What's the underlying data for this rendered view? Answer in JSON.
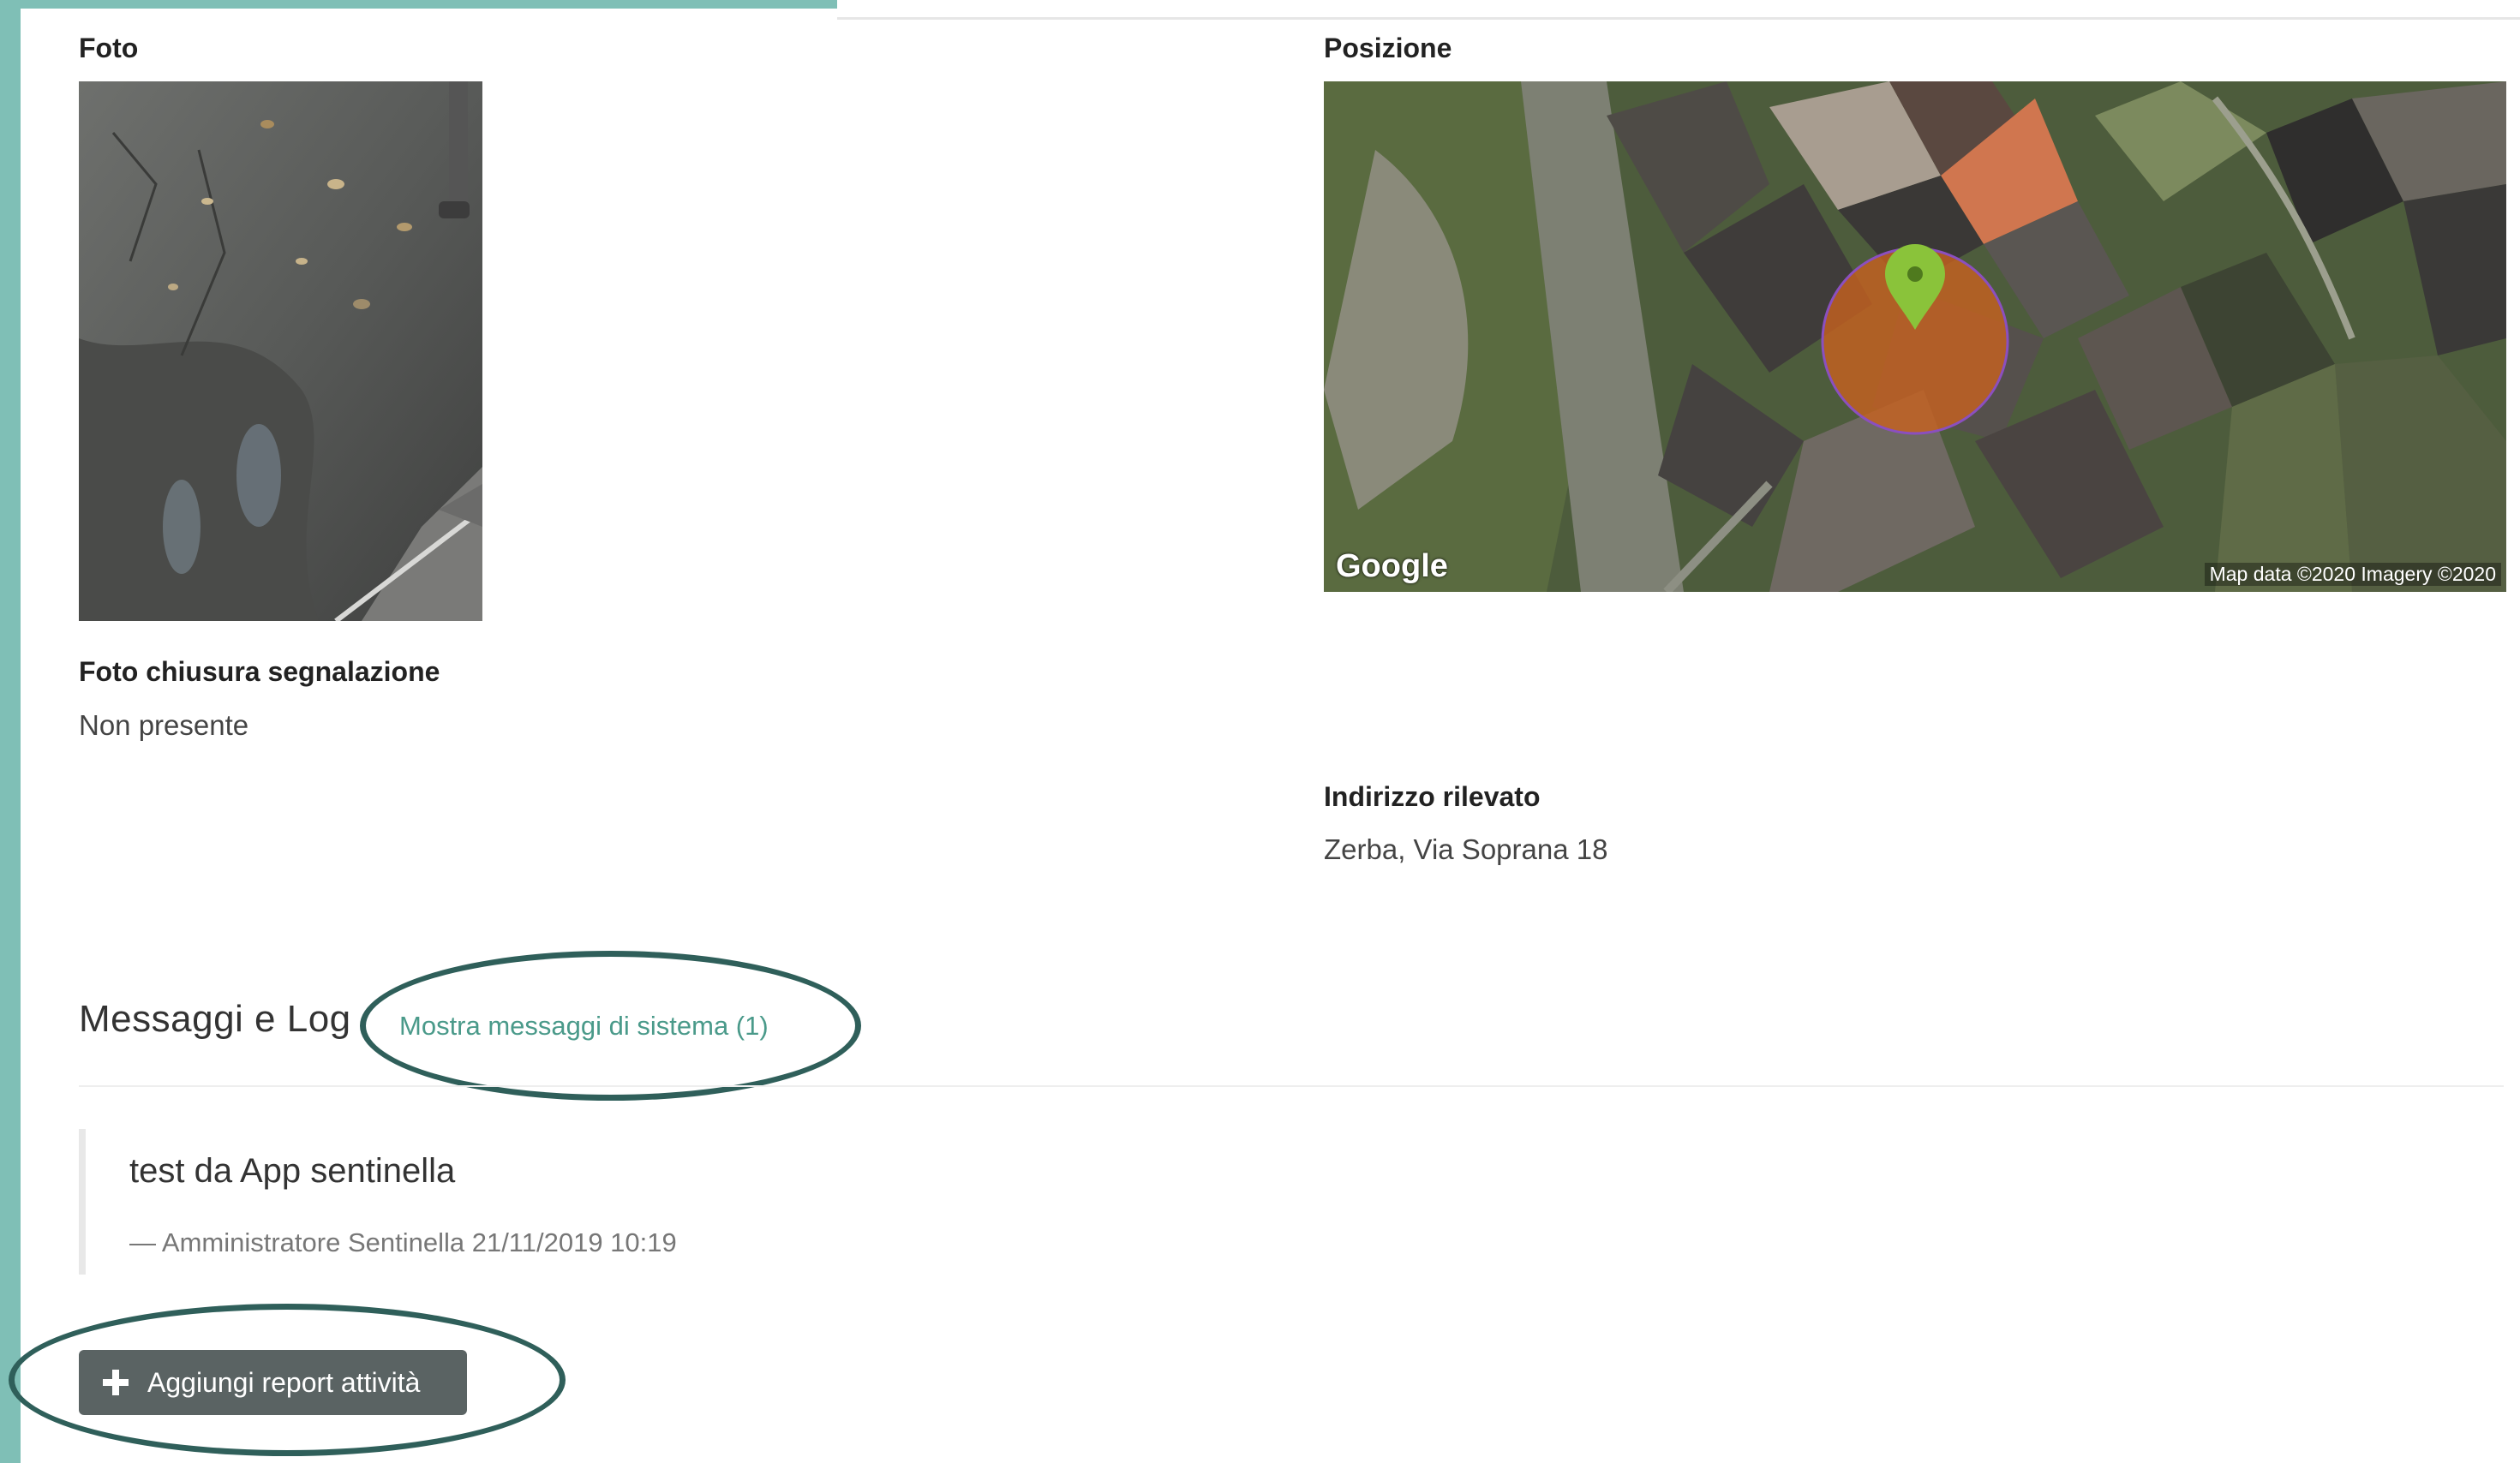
{
  "fields": {
    "photo_label": "Foto",
    "position_label": "Posizione",
    "closing_photo_label": "Foto chiusura segnalazione",
    "closing_photo_value": "Non presente",
    "address_label": "Indirizzo rilevato",
    "address_value": "Zerba, Via Soprana 18"
  },
  "map": {
    "brand": "Google",
    "attribution": "Map data ©2020  Imagery ©2020",
    "marker_color": "#8ac33a",
    "accuracy_circle_color": "#c8621f",
    "marker_icon": "map-pin-icon"
  },
  "messages": {
    "section_title": "Messaggi e Log",
    "system_link": "Mostra messaggi di sistema (1)",
    "items": [
      {
        "text": "test da App sentinella",
        "meta": "— Amministratore Sentinella 21/11/2019 10:19"
      }
    ]
  },
  "actions": {
    "add_report_label": "Aggiungi report attività",
    "add_report_icon": "plus-icon"
  },
  "colors": {
    "accent": "#7fbfb6",
    "highlight_oval": "#2f5f5a",
    "link": "#4a9a8a",
    "button_bg": "#5a6363"
  }
}
